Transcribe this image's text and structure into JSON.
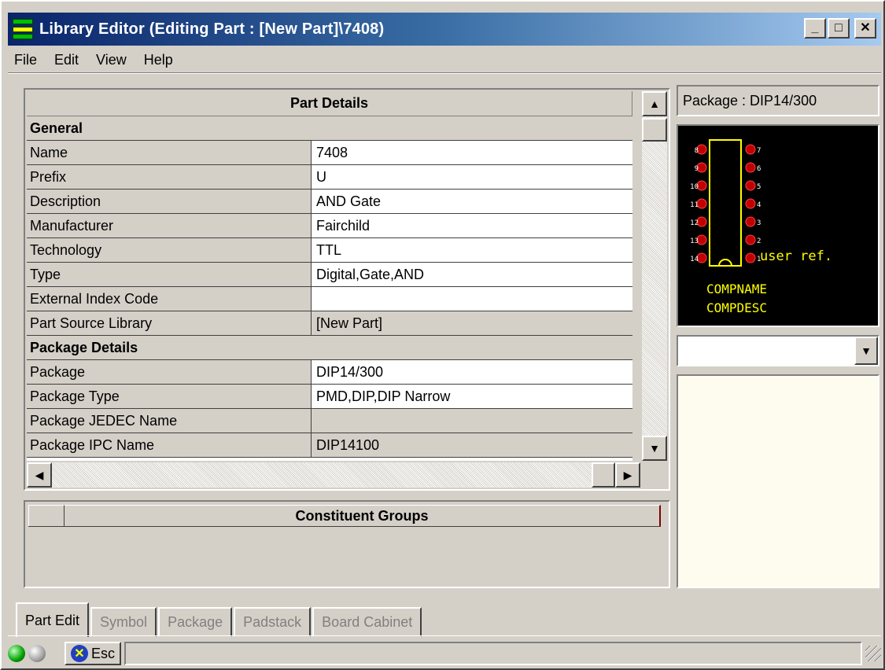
{
  "window": {
    "title": "Library Editor (Editing Part : [New Part]\\7408)"
  },
  "window_buttons": {
    "minimize": "_",
    "maximize": "□",
    "close": "✕"
  },
  "menu": [
    "File",
    "Edit",
    "View",
    "Help"
  ],
  "part_details": {
    "header": "Part Details",
    "general_label": "General",
    "general_rows": [
      {
        "label": "Name",
        "value": "7408"
      },
      {
        "label": "Prefix",
        "value": "U"
      },
      {
        "label": "Description",
        "value": "AND Gate"
      },
      {
        "label": "Manufacturer",
        "value": "Fairchild"
      },
      {
        "label": "Technology",
        "value": "TTL"
      },
      {
        "label": "Type",
        "value": "Digital,Gate,AND"
      },
      {
        "label": "External Index Code",
        "value": ""
      },
      {
        "label": "Part Source Library",
        "value": "[New Part]"
      }
    ],
    "package_label": "Package Details",
    "package_rows": [
      {
        "label": "Package",
        "value": "DIP14/300"
      },
      {
        "label": "Package Type",
        "value": "PMD,DIP,DIP Narrow"
      },
      {
        "label": "Package JEDEC Name",
        "value": ""
      },
      {
        "label": "Package IPC Name",
        "value": "DIP14100"
      }
    ]
  },
  "constituent_groups": {
    "header": "Constituent Groups"
  },
  "preview": {
    "package_label": "Package : DIP14/300",
    "left_pins": [
      "8",
      "9",
      "10",
      "11",
      "12",
      "13",
      "14"
    ],
    "right_pins": [
      "7",
      "6",
      "5",
      "4",
      "3",
      "2",
      "1"
    ],
    "user_ref": "user ref.",
    "compname": "COMPNAME",
    "compdesc": "COMPDESC"
  },
  "combo": {
    "value": ""
  },
  "tabs": [
    {
      "label": "Part Edit",
      "active": true
    },
    {
      "label": "Symbol",
      "active": false
    },
    {
      "label": "Package",
      "active": false
    },
    {
      "label": "Padstack",
      "active": false
    },
    {
      "label": "Board Cabinet",
      "active": false
    }
  ],
  "status": {
    "esc_label": "Esc"
  }
}
